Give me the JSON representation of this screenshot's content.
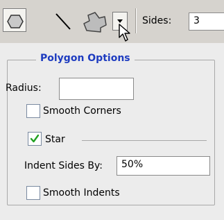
{
  "toolbar": {
    "sides_label": "Sides:",
    "sides_value": "3",
    "tools": [
      {
        "icon": "polygon-icon",
        "selected": true
      },
      {
        "icon": "line-icon",
        "selected": false
      },
      {
        "icon": "custom-shape-icon",
        "selected": false
      },
      {
        "icon": "chevron-down-icon",
        "selected": false
      }
    ]
  },
  "polygon_options": {
    "title": "Polygon Options",
    "radius_label": "Radius:",
    "radius_value": "",
    "smooth_corners_label": "Smooth Corners",
    "smooth_corners_checked": false,
    "star_label": "Star",
    "star_checked": true,
    "indent_label": "Indent Sides By:",
    "indent_value": "50%",
    "smooth_indents_label": "Smooth Indents",
    "smooth_indents_checked": false
  },
  "colors": {
    "title_blue": "#1e3cc0",
    "check_green": "#21a121"
  }
}
